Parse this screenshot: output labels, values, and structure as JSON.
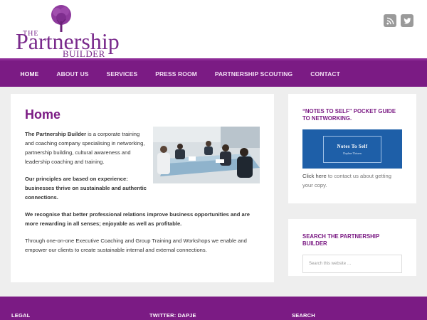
{
  "logo": {
    "the": "THE",
    "main": "Partnership",
    "sub": "BUILDER",
    "color": "#7a2b8c"
  },
  "social": [
    {
      "name": "rss-icon"
    },
    {
      "name": "twitter-icon"
    }
  ],
  "nav": {
    "color": "#7b1b84",
    "items": [
      {
        "label": "HOME"
      },
      {
        "label": "ABOUT US"
      },
      {
        "label": "SERVICES"
      },
      {
        "label": "PRESS ROOM"
      },
      {
        "label": "PARTNERSHIP SCOUTING"
      },
      {
        "label": "CONTACT"
      }
    ]
  },
  "main": {
    "title": "Home",
    "intro_bold": "The Partnership Builder",
    "intro_rest": " is a corporate training and coaching company specialising in networking, partnership building, cultural awareness and leadership coaching and training.",
    "principles": "Our principles are based on experience: businesses thrive on sustainable and authentic connections.",
    "recognise": "We recognise that better professional relations improve business opportunities and are more rewarding in all senses; enjoyable as well as profitable.",
    "through": "Through one-on-one Executive Coaching and Group Training and Workshops we enable and empower our clients to create sustainable internal and external connections."
  },
  "sidebar": {
    "guide_title": "“NOTES TO SELF” POCKET GUIDE TO NETWORKING.",
    "book_title": "Notes To Self",
    "book_author": "Daphne Thissen",
    "click_link": "Click here",
    "click_rest": " to contact us about getting your copy.",
    "search_title": "SEARCH THE PARTNERSHIP BUILDER",
    "search_placeholder": "Search this website …"
  },
  "footer": {
    "legal": "LEGAL",
    "twitter": "TWITTER: DAPJE",
    "search": "SEARCH"
  }
}
